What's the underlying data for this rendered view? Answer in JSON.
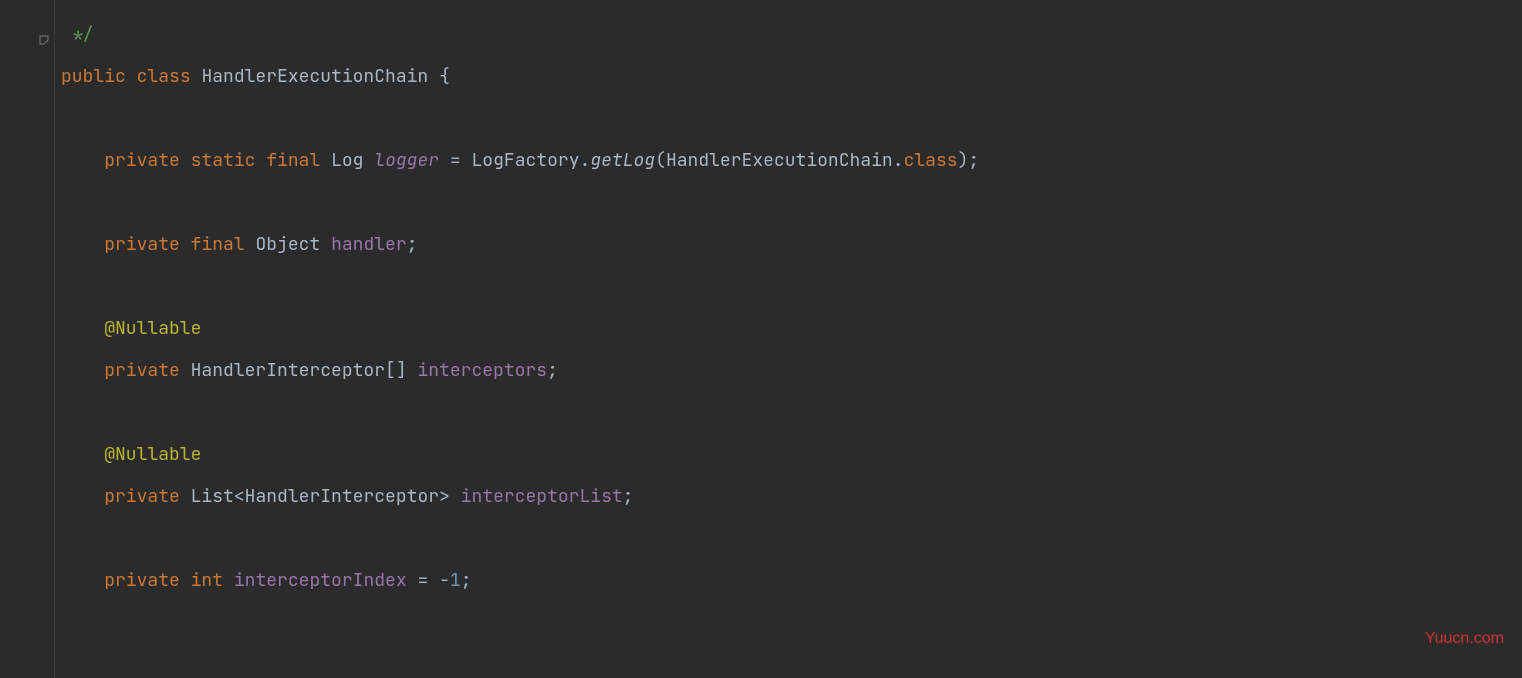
{
  "code": {
    "comment_end": " */",
    "decl": {
      "kw_public": "public",
      "kw_class": "class",
      "class_name": "HandlerExecutionChain",
      "brace": "{"
    },
    "logger_line": {
      "indent": "    ",
      "kw_private": "private",
      "kw_static": "static",
      "kw_final": "final",
      "type": "Log",
      "field": "logger",
      "eq": " = ",
      "factory_class": "LogFactory",
      "dot1": ".",
      "method": "getLog",
      "open": "(",
      "arg_class": "HandlerExecutionChain",
      "dot2": ".",
      "class_kw": "class",
      "close": ");"
    },
    "handler_line": {
      "indent": "    ",
      "kw_private": "private",
      "kw_final": "final",
      "type": "Object",
      "field": "handler",
      "semi": ";"
    },
    "nullable1": {
      "indent": "    ",
      "annotation": "@Nullable"
    },
    "interceptors_line": {
      "indent": "    ",
      "kw_private": "private",
      "type": "HandlerInterceptor",
      "brackets": "[]",
      "field": "interceptors",
      "semi": ";"
    },
    "nullable2": {
      "indent": "    ",
      "annotation": "@Nullable"
    },
    "interceptor_list_line": {
      "indent": "    ",
      "kw_private": "private",
      "type": "List",
      "lt": "<",
      "generic": "HandlerInterceptor",
      "gt": ">",
      "field": "interceptorList",
      "semi": ";"
    },
    "index_line": {
      "indent": "    ",
      "kw_private": "private",
      "kw_int": "int",
      "field": "interceptorIndex",
      "eq": " = ",
      "minus": "-",
      "num": "1",
      "semi": ";"
    }
  },
  "watermark": "Yuucn.com"
}
